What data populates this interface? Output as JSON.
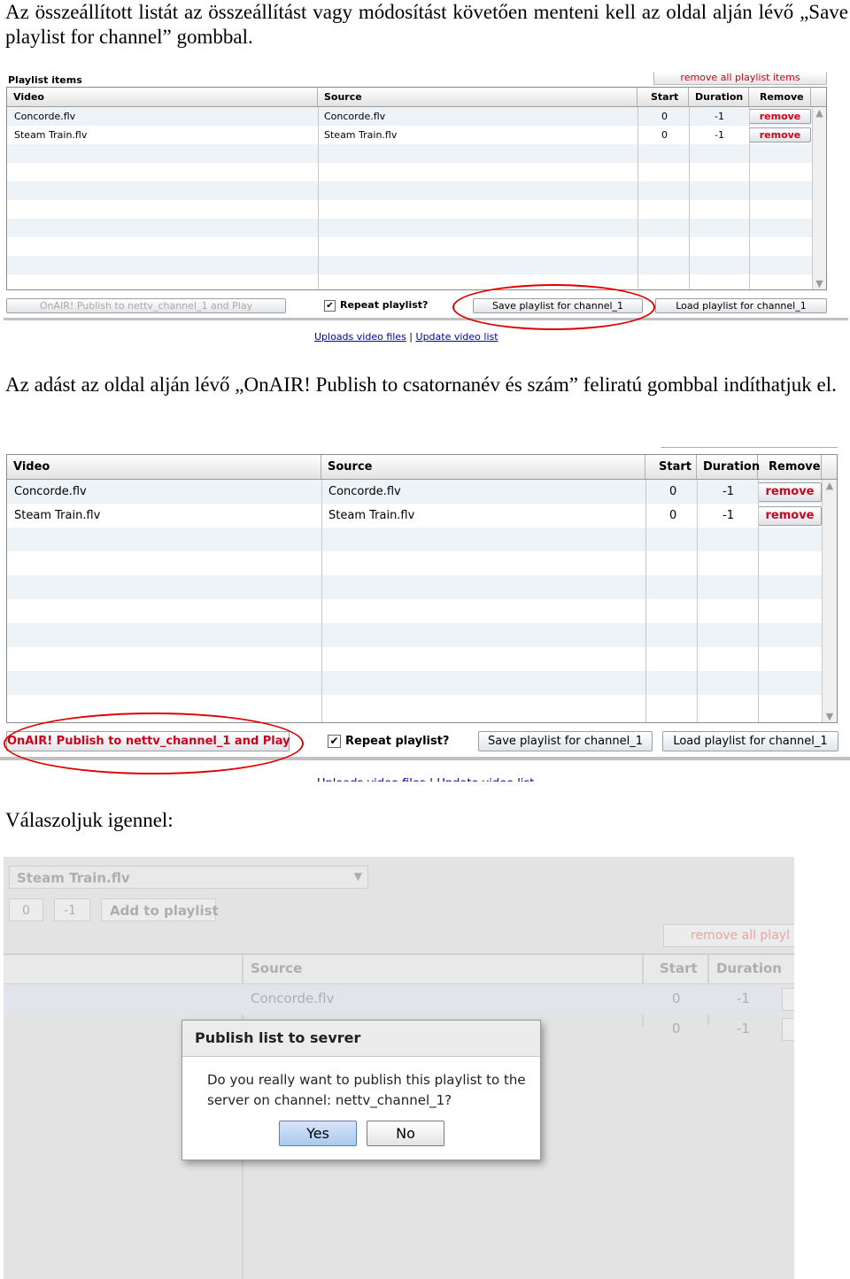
{
  "paragraphs": {
    "p1": "Az összeállított listát az összeállítást vagy módosítást követően menteni kell az oldal alján lévő „Save playlist for channel” gombbal.",
    "p2": "Az adást az oldal alján lévő „OnAIR! Publish to csatornanév és szám” feliratú gombbal indíthatjuk el.",
    "p3": "Válaszoljuk igennel:"
  },
  "playlist": {
    "title": "Playlist items",
    "remove_all_label": "remove all playlist items",
    "columns": [
      "Video",
      "Source",
      "Start",
      "Duration",
      "Remove"
    ],
    "rows": [
      {
        "video": "Concorde.flv",
        "source": "Concorde.flv",
        "start": "0",
        "duration": "-1",
        "remove": "remove"
      },
      {
        "video": "Steam Train.flv",
        "source": "Steam Train.flv",
        "start": "0",
        "duration": "-1",
        "remove": "remove"
      }
    ],
    "onair_label": "OnAIR! Publish to nettv_channel_1 and Play",
    "repeat_label": "Repeat playlist?",
    "save_label": "Save playlist for channel_1",
    "load_label": "Load playlist for channel_1",
    "link_uploads": "Uploads video files",
    "link_separator": "|",
    "link_update": "Update video list"
  },
  "dialog_screen": {
    "select_value": "Steam Train.flv",
    "start_value": "0",
    "duration_value": "-1",
    "add_label": "Add to playlist",
    "remove_all_partial": "remove all playl",
    "col_source": "Source",
    "col_start": "Start",
    "col_duration": "Duration",
    "row1_source": "Concorde.flv",
    "row1_start": "0",
    "row1_duration": "-1",
    "row2_start": "0",
    "row2_duration": "-1",
    "dialog": {
      "title": "Publish list to sevrer",
      "message": "Do you really want to publish this playlist to the server on channel: nettv_channel_1?",
      "yes": "Yes",
      "no": "No"
    }
  }
}
